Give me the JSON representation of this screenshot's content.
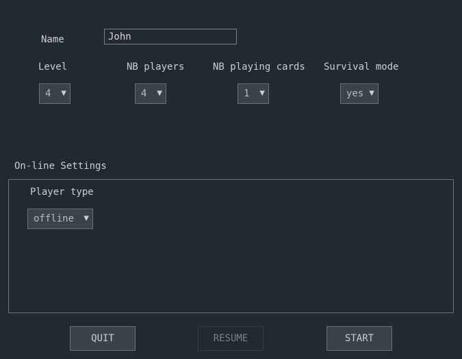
{
  "player": {
    "name_label": "Name",
    "name_value": "John"
  },
  "settings": {
    "level": {
      "label": "Level",
      "value": "4"
    },
    "nb_players": {
      "label": "NB players",
      "value": "4"
    },
    "nb_playing_cards": {
      "label": "NB playing cards",
      "value": "1"
    },
    "survival_mode": {
      "label": "Survival mode",
      "value": "yes"
    }
  },
  "online": {
    "section_label": "On-line Settings",
    "player_type_label": "Player type",
    "player_type_value": "offline"
  },
  "buttons": {
    "quit": "QUIT",
    "resume": "RESUME",
    "start": "START"
  },
  "icons": {
    "dropdown": "chevron-down-icon"
  },
  "colors": {
    "background": "#222930",
    "control": "#3b4249",
    "border": "#6a7178",
    "text": "#c9ced3"
  }
}
